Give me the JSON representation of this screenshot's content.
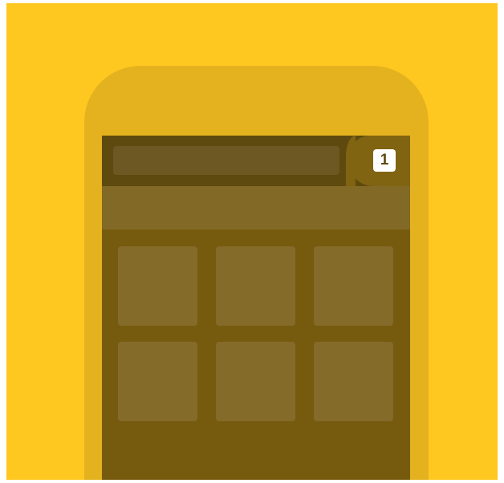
{
  "browser": {
    "tab_count": "1",
    "url_value": ""
  },
  "colors": {
    "background": "#ffc820",
    "phone_body": "#e5b21f",
    "screen": "#765b0f",
    "url_bar_row": "#5e4a0e",
    "url_input": "#6d5722",
    "tab_area": "#806412",
    "toolbar_band": "#826a26",
    "tile": "#846b2a",
    "tab_counter": "#ffffff"
  },
  "speed_dial": {
    "tiles": [
      {
        "label": ""
      },
      {
        "label": ""
      },
      {
        "label": ""
      },
      {
        "label": ""
      },
      {
        "label": ""
      },
      {
        "label": ""
      }
    ]
  }
}
